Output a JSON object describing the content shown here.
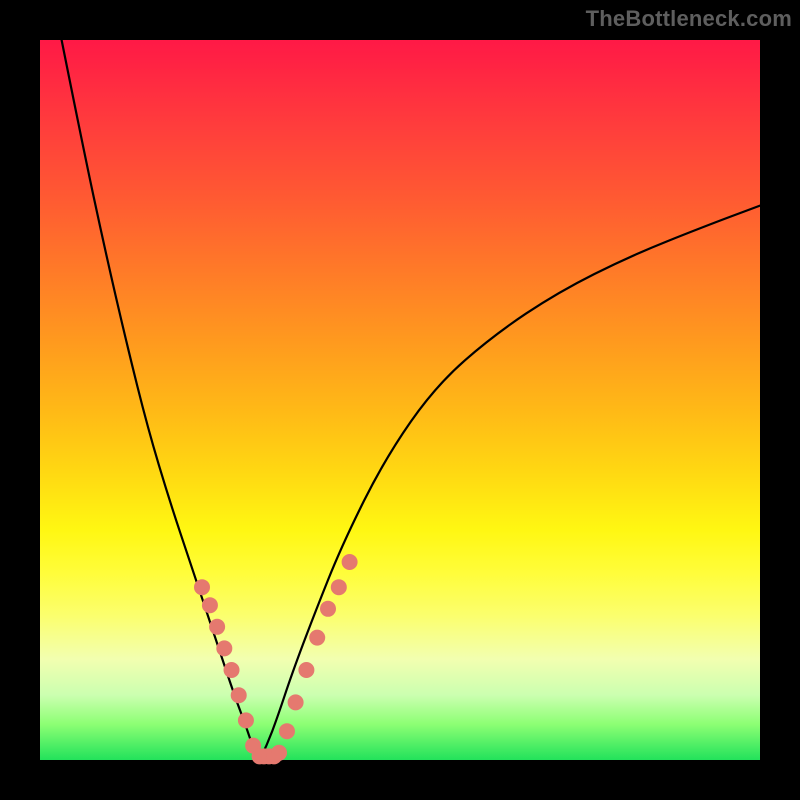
{
  "watermark": "TheBottleneck.com",
  "chart_data": {
    "type": "line",
    "title": "",
    "xlabel": "",
    "ylabel": "",
    "xlim": [
      0,
      100
    ],
    "ylim": [
      0,
      100
    ],
    "grid": false,
    "legend": false,
    "background_gradient": {
      "top": "#ff1946",
      "bottom": "#22e25b",
      "description": "vertical red→orange→yellow→green gradient"
    },
    "series": [
      {
        "name": "left-branch",
        "x": [
          3,
          6,
          9,
          12,
          15,
          18,
          21,
          23,
          25,
          27,
          28.5,
          29.5,
          30.5
        ],
        "y": [
          100,
          85,
          71,
          58,
          46,
          36,
          27,
          21,
          15,
          9,
          5,
          2,
          0
        ]
      },
      {
        "name": "right-branch",
        "x": [
          30.5,
          31.5,
          33,
          35,
          38,
          42,
          48,
          55,
          63,
          72,
          82,
          92,
          100
        ],
        "y": [
          0,
          2,
          6,
          12,
          20,
          30,
          42,
          52,
          59,
          65,
          70,
          74,
          77
        ]
      }
    ],
    "markers": {
      "name": "sample-points",
      "color": "#e5796f",
      "radius_px": 8,
      "points_xy": [
        [
          22.5,
          24
        ],
        [
          23.6,
          21.5
        ],
        [
          24.6,
          18.5
        ],
        [
          25.6,
          15.5
        ],
        [
          26.6,
          12.5
        ],
        [
          27.6,
          9
        ],
        [
          28.6,
          5.5
        ],
        [
          29.6,
          2
        ],
        [
          30.5,
          0.5
        ],
        [
          31.1,
          0.5
        ],
        [
          31.8,
          0.5
        ],
        [
          32.5,
          0.5
        ],
        [
          33.2,
          1
        ],
        [
          34.3,
          4
        ],
        [
          35.5,
          8
        ],
        [
          37,
          12.5
        ],
        [
          38.5,
          17
        ],
        [
          40,
          21
        ],
        [
          41.5,
          24
        ],
        [
          43,
          27.5
        ]
      ]
    }
  }
}
